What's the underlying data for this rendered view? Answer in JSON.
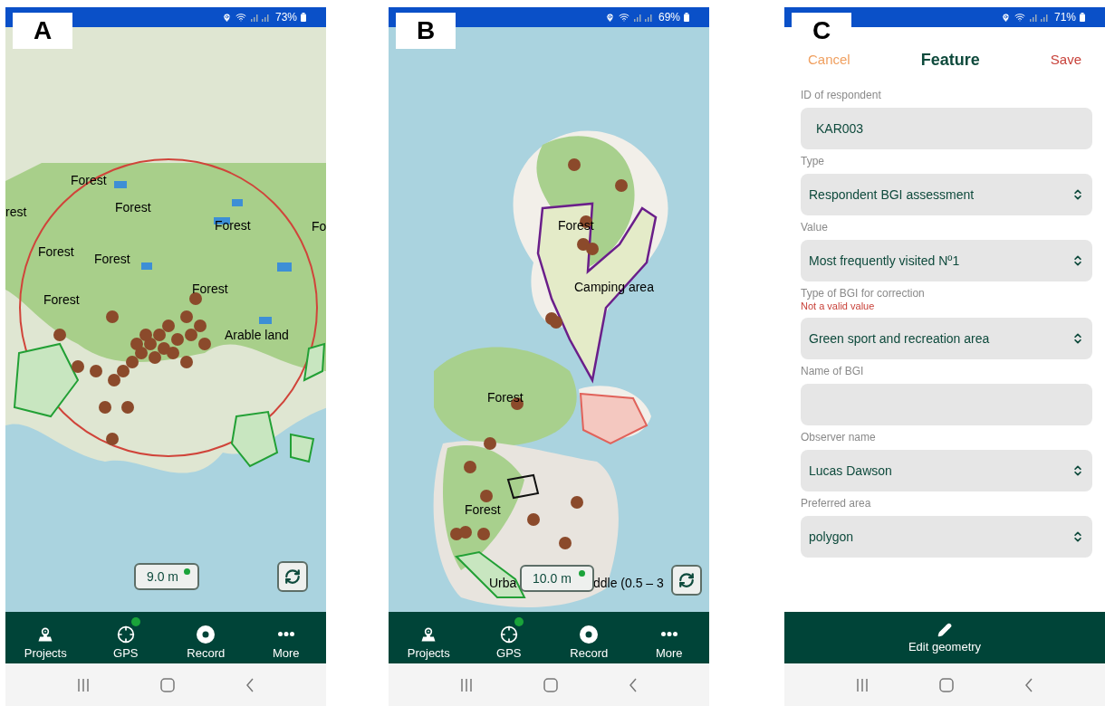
{
  "panels": [
    {
      "label": "A",
      "kind": "map",
      "status": {
        "battery": "73%"
      },
      "map": {
        "labels": [
          {
            "text": "Forest"
          },
          {
            "text": "Forest"
          },
          {
            "text": "rest"
          },
          {
            "text": "Forest"
          },
          {
            "text": "Fo"
          },
          {
            "text": "Forest"
          },
          {
            "text": "Forest"
          },
          {
            "text": "Forest"
          },
          {
            "text": "Forest"
          },
          {
            "text": "Arable land"
          }
        ],
        "accuracy": "9.0 m",
        "gps_fix": true
      },
      "nav": [
        {
          "label": "Projects",
          "dot": false
        },
        {
          "label": "GPS",
          "dot": true
        },
        {
          "label": "Record",
          "dot": false
        },
        {
          "label": "More",
          "dot": false
        }
      ]
    },
    {
      "label": "B",
      "kind": "map",
      "status": {
        "battery": "69%"
      },
      "map": {
        "labels": [
          {
            "text": "Forest"
          },
          {
            "text": "Camping area"
          },
          {
            "text": "Forest"
          },
          {
            "text": "Forest"
          },
          {
            "text": "Urba"
          },
          {
            "text": "ddle (0.5 – 3"
          }
        ],
        "accuracy": "10.0 m",
        "gps_fix": true
      },
      "nav": [
        {
          "label": "Projects",
          "dot": false
        },
        {
          "label": "GPS",
          "dot": true
        },
        {
          "label": "Record",
          "dot": false
        },
        {
          "label": "More",
          "dot": false
        }
      ]
    },
    {
      "label": "C",
      "kind": "form",
      "status": {
        "battery": "71%"
      },
      "form": {
        "cancel": "Cancel",
        "title": "Feature",
        "save": "Save",
        "fields": [
          {
            "label": "ID of respondent",
            "kind": "text",
            "value": "KAR003"
          },
          {
            "label": "Type",
            "kind": "select",
            "value": "Respondent BGI assessment"
          },
          {
            "label": "Value",
            "kind": "select",
            "value": "Most frequently visited Nº1"
          },
          {
            "label": "Type of BGI for correction",
            "error": "Not a valid value",
            "kind": "select",
            "value": "Green sport and recreation area"
          },
          {
            "label": "Name of BGI",
            "kind": "text"
          },
          {
            "label": "Observer name",
            "kind": "select",
            "value": "Lucas Dawson"
          },
          {
            "label": "Preferred area",
            "kind": "select",
            "value": "polygon"
          }
        ],
        "action": "Edit geometry"
      }
    }
  ]
}
